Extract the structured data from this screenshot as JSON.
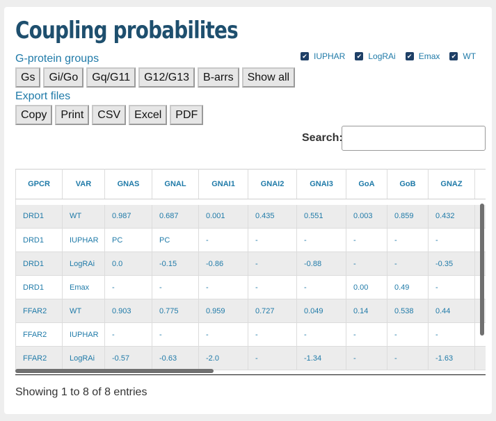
{
  "title": "Coupling probabilites",
  "groups": {
    "label": "G-protein groups",
    "buttons": [
      "Gs",
      "Gi/Go",
      "Gq/G11",
      "G12/G13",
      "B-arrs",
      "Show all"
    ]
  },
  "export": {
    "label": "Export files",
    "buttons": [
      "Copy",
      "Print",
      "CSV",
      "Excel",
      "PDF"
    ]
  },
  "filters": [
    {
      "label": "IUPHAR",
      "checked": true
    },
    {
      "label": "LogRAi",
      "checked": true
    },
    {
      "label": "Emax",
      "checked": true
    },
    {
      "label": "WT",
      "checked": true
    }
  ],
  "search": {
    "label": "Search:",
    "value": ""
  },
  "table": {
    "columns": [
      "GPCR",
      "VAR",
      "GNAS",
      "GNAL",
      "GNAI1",
      "GNAI2",
      "GNAI3",
      "GoA",
      "GoB",
      "GNAZ"
    ],
    "rows": [
      [
        "DRD1",
        "WT",
        "0.987",
        "0.687",
        "0.001",
        "0.435",
        "0.551",
        "0.003",
        "0.859",
        "0.432"
      ],
      [
        "DRD1",
        "IUPHAR",
        "PC",
        "PC",
        "-",
        "-",
        "-",
        "-",
        "-",
        "-"
      ],
      [
        "DRD1",
        "LogRAi",
        "0.0",
        "-0.15",
        "-0.86",
        "-",
        "-0.88",
        "-",
        "-",
        "-0.35"
      ],
      [
        "DRD1",
        "Emax",
        "-",
        "-",
        "-",
        "-",
        "-",
        "0.00",
        "0.49",
        "-"
      ],
      [
        "FFAR2",
        "WT",
        "0.903",
        "0.775",
        "0.959",
        "0.727",
        "0.049",
        "0.14",
        "0.538",
        "0.44"
      ],
      [
        "FFAR2",
        "IUPHAR",
        "-",
        "-",
        "-",
        "-",
        "-",
        "-",
        "-",
        "-"
      ],
      [
        "FFAR2",
        "LogRAi",
        "-0.57",
        "-0.63",
        "-2.0",
        "-",
        "-1.34",
        "-",
        "-",
        "-1.63"
      ]
    ]
  },
  "info": "Showing 1 to 8 of 8 entries",
  "colors": {
    "accent": "#1f7aa8",
    "title": "#1e4f6e",
    "checkbox": "#1e3f66",
    "stripe": "#ececec"
  }
}
